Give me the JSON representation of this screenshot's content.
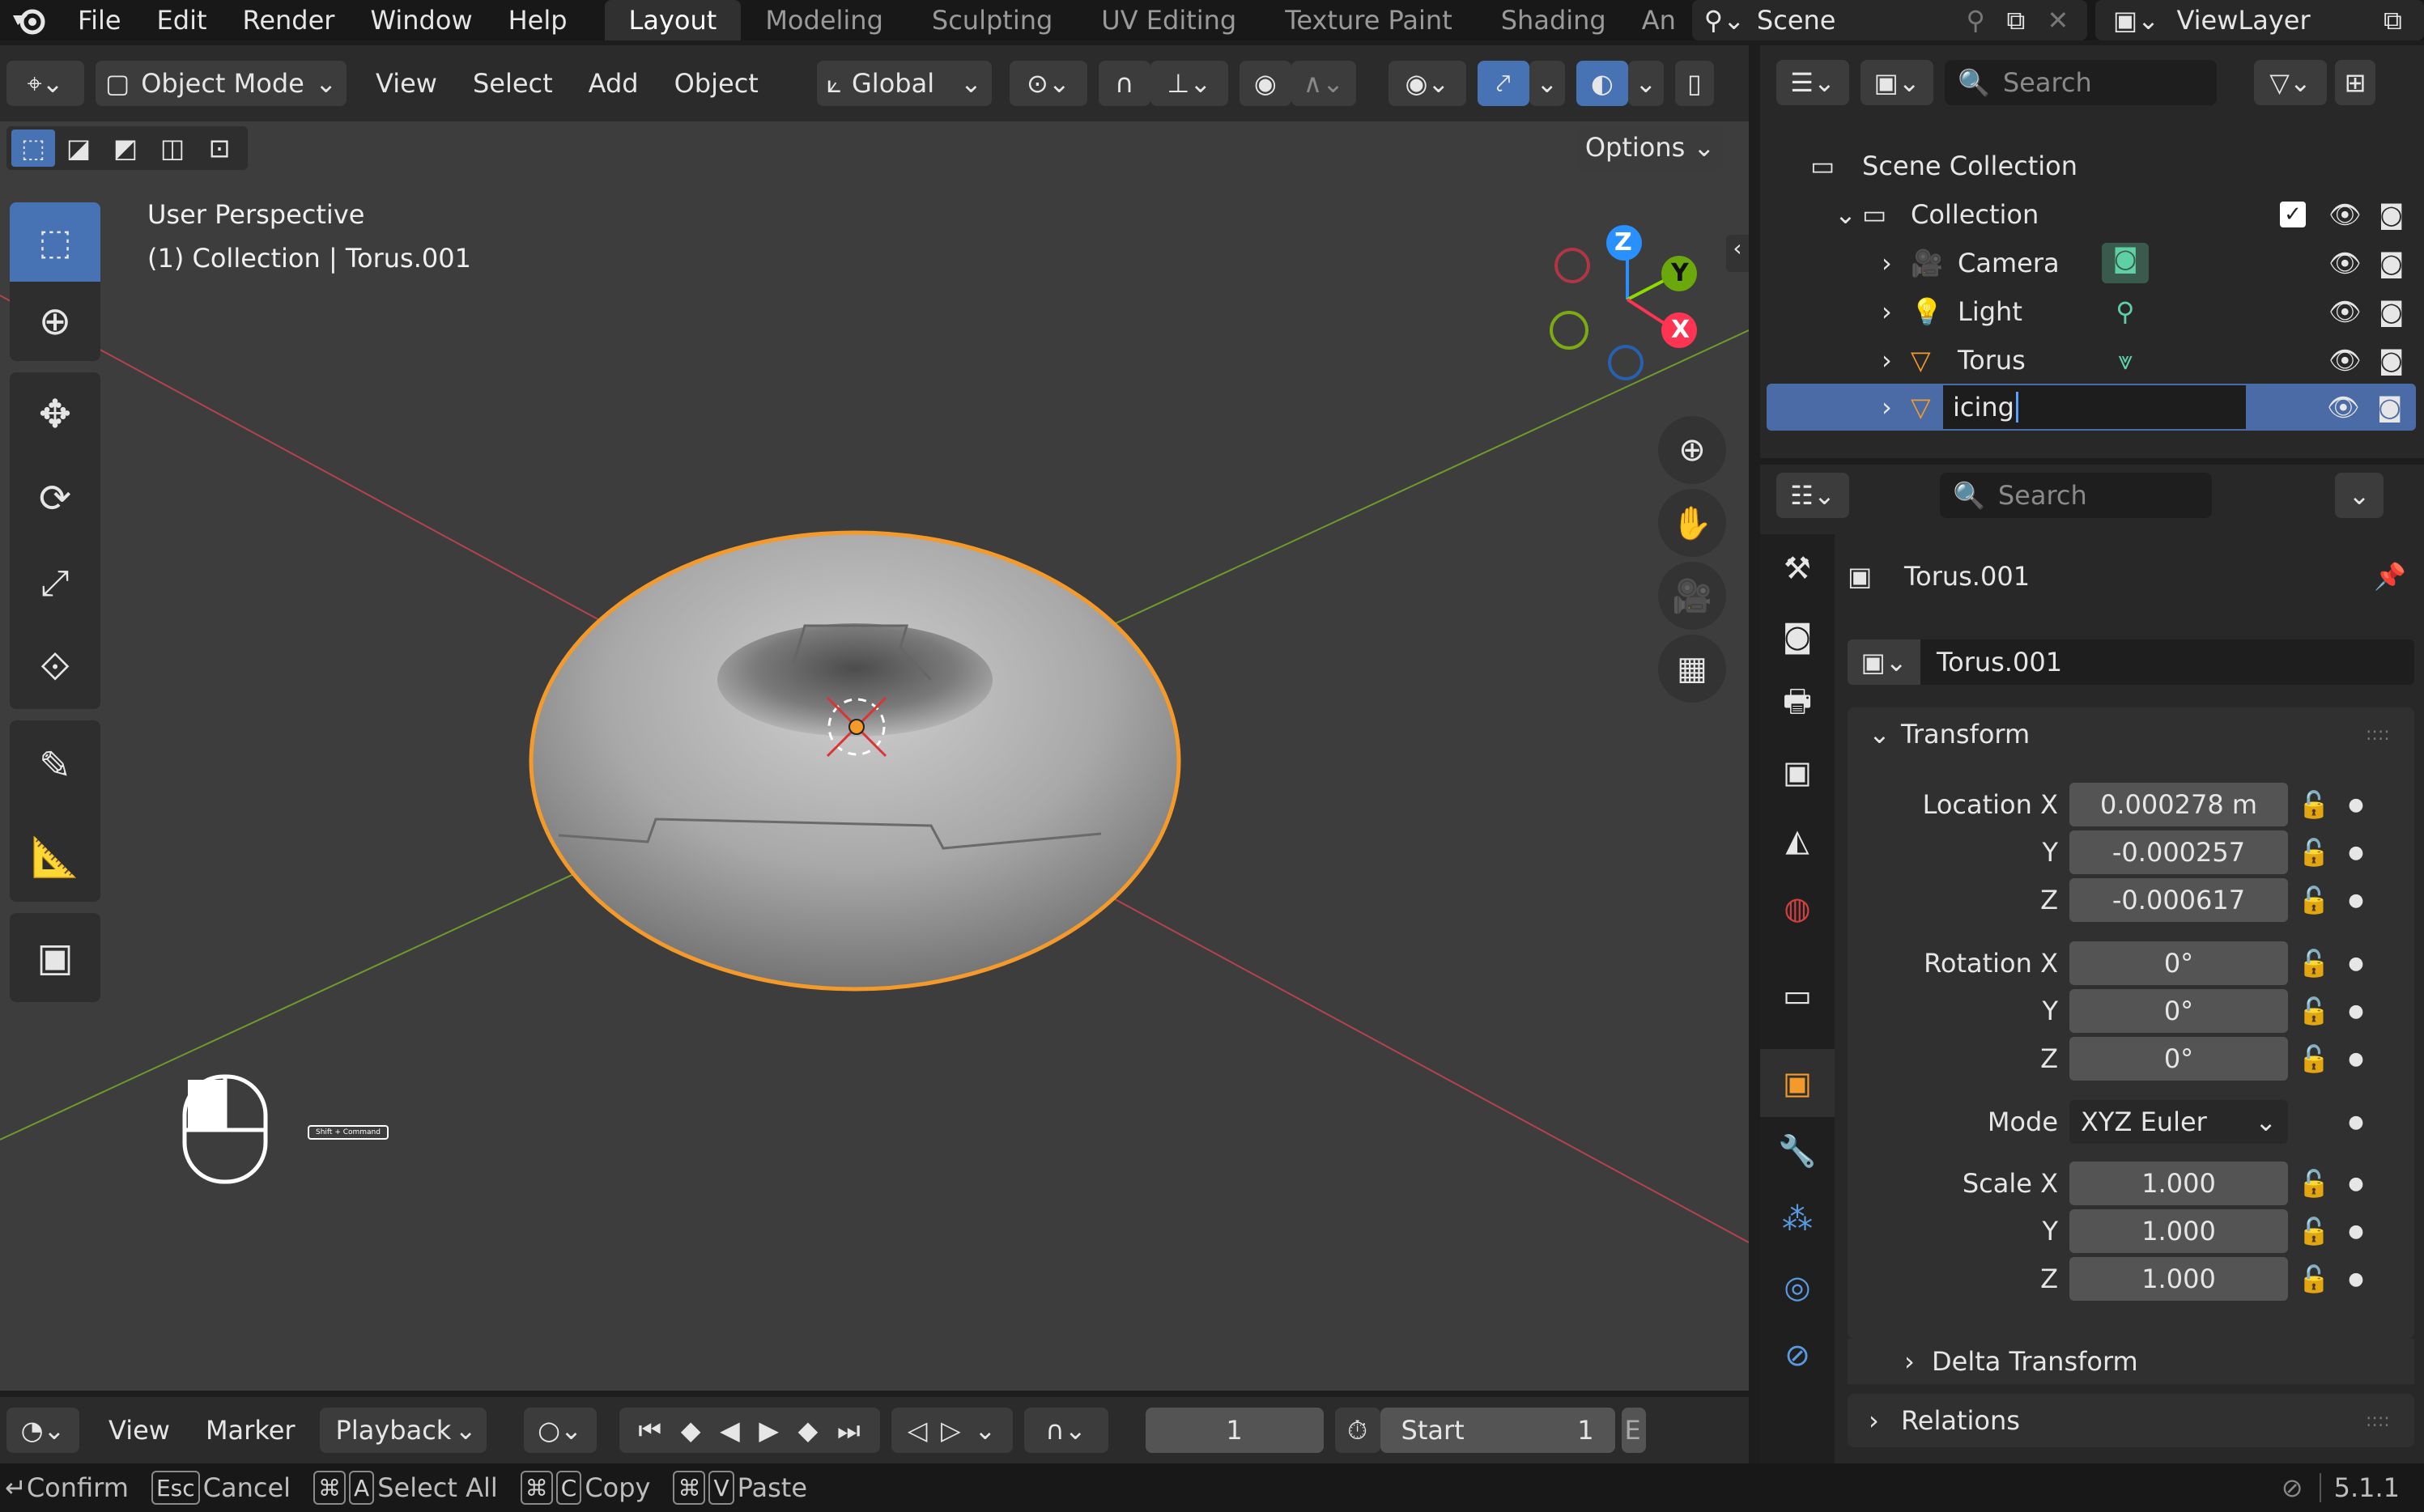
{
  "topbar": {
    "menus": [
      "File",
      "Edit",
      "Render",
      "Window",
      "Help"
    ],
    "workspace_tabs": [
      "Layout",
      "Modeling",
      "Sculpting",
      "UV Editing",
      "Texture Paint",
      "Shading",
      "An"
    ],
    "active_tab": "Layout",
    "scene": "Scene",
    "view_layer": "ViewLayer"
  },
  "viewport_header": {
    "mode": "Object Mode",
    "menus": [
      "View",
      "Select",
      "Add",
      "Object"
    ],
    "orientation": "Global",
    "options": "Options"
  },
  "viewport": {
    "perspective": "User Perspective",
    "context": "(1) Collection | Torus.001",
    "gizmo": {
      "z": "Z",
      "y": "Y",
      "x": "X"
    },
    "key_hint": "Shift + Command"
  },
  "outliner": {
    "search_placeholder": "Search",
    "scene_collection": "Scene Collection",
    "collection": "Collection",
    "items": [
      {
        "name": "Camera",
        "icon": "camera-icon",
        "data_icon": "camera-data-icon"
      },
      {
        "name": "Light",
        "icon": "light-icon",
        "data_icon": "light-data-icon"
      },
      {
        "name": "Torus",
        "icon": "mesh-icon",
        "data_icon": "mesh-data-icon"
      }
    ],
    "editing_value": "icing"
  },
  "properties": {
    "search_placeholder": "Search",
    "object_name": "Torus.001",
    "object_field": "Torus.001",
    "transform_title": "Transform",
    "location_label": "Location X",
    "location": [
      "0.000278 m",
      "-0.000257",
      "-0.000617"
    ],
    "rotation_label": "Rotation X",
    "rotation": [
      "0°",
      "0°",
      "0°"
    ],
    "mode_label": "Mode",
    "mode_value": "XYZ Euler",
    "scale_label": "Scale X",
    "scale": [
      "1.000",
      "1.000",
      "1.000"
    ],
    "axis_y": "Y",
    "axis_z": "Z",
    "delta_transform": "Delta Transform",
    "relations": "Relations"
  },
  "timeline": {
    "menus": [
      "View",
      "Marker"
    ],
    "playback": "Playback",
    "current_frame": "1",
    "start_label": "Start",
    "start_value": "1",
    "end_label": "E"
  },
  "statusbar": {
    "confirm": "Confirm",
    "esc_key": "Esc",
    "cancel": "Cancel",
    "cmd_key": "⌘",
    "a_key": "A",
    "select_all": "Select All",
    "c_key": "C",
    "copy": "Copy",
    "v_key": "V",
    "paste": "Paste",
    "version": "5.1.1"
  },
  "colors": {
    "accent": "#4772b3",
    "selection": "#ffa033",
    "x_axis": "#ff3352",
    "y_axis": "#8bdc00",
    "z_axis": "#2890ff"
  }
}
